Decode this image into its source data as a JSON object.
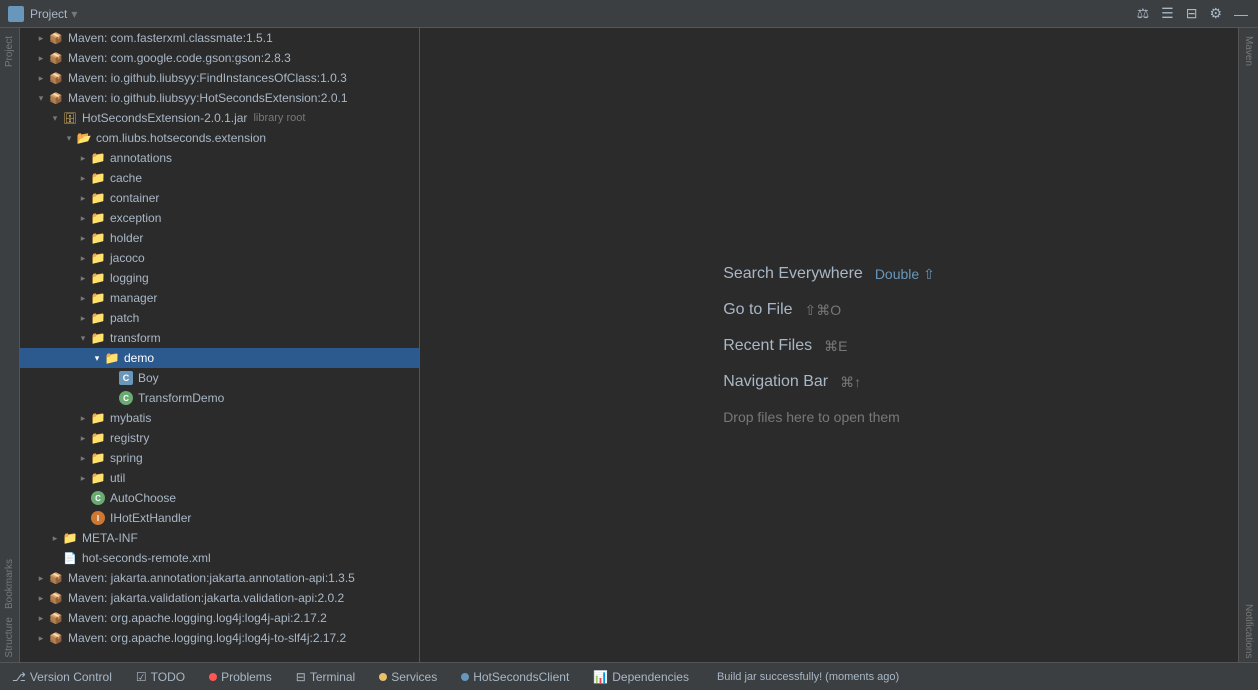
{
  "toolbar": {
    "title": "Project",
    "dropdown_icon": "▾",
    "icons": [
      "balance-icon",
      "list-icon",
      "gear-icon",
      "settings-icon",
      "minimize-icon"
    ]
  },
  "tree": {
    "items": [
      {
        "id": "maven-classmate",
        "label": "Maven: com.fasterxml.classmate:1.5.1",
        "indent": 1,
        "arrow": "closed",
        "icon": "maven",
        "selected": false
      },
      {
        "id": "maven-gson",
        "label": "Maven: com.google.code.gson:gson:2.8.3",
        "indent": 1,
        "arrow": "closed",
        "icon": "maven",
        "selected": false
      },
      {
        "id": "maven-liubsyy",
        "label": "Maven: io.github.liubsyy:FindInstancesOfClass:1.0.3",
        "indent": 1,
        "arrow": "closed",
        "icon": "maven",
        "selected": false
      },
      {
        "id": "maven-hotseconds",
        "label": "Maven: io.github.liubsyy:HotSecondsExtension:2.0.1",
        "indent": 1,
        "arrow": "open",
        "icon": "maven",
        "selected": false
      },
      {
        "id": "hotseconds-jar",
        "label": "HotSecondsExtension-2.0.1.jar",
        "indent": 2,
        "arrow": "open",
        "icon": "jar",
        "label2": "library root",
        "selected": false
      },
      {
        "id": "com-liubs",
        "label": "com.liubs.hotseconds.extension",
        "indent": 3,
        "arrow": "open",
        "icon": "package",
        "selected": false
      },
      {
        "id": "annotations",
        "label": "annotations",
        "indent": 4,
        "arrow": "closed",
        "icon": "folder",
        "selected": false
      },
      {
        "id": "cache",
        "label": "cache",
        "indent": 4,
        "arrow": "closed",
        "icon": "folder",
        "selected": false
      },
      {
        "id": "container",
        "label": "container",
        "indent": 4,
        "arrow": "closed",
        "icon": "folder",
        "selected": false
      },
      {
        "id": "exception",
        "label": "exception",
        "indent": 4,
        "arrow": "closed",
        "icon": "folder",
        "selected": false
      },
      {
        "id": "holder",
        "label": "holder",
        "indent": 4,
        "arrow": "closed",
        "icon": "folder",
        "selected": false
      },
      {
        "id": "jacoco",
        "label": "jacoco",
        "indent": 4,
        "arrow": "closed",
        "icon": "folder",
        "selected": false
      },
      {
        "id": "logging",
        "label": "logging",
        "indent": 4,
        "arrow": "closed",
        "icon": "folder",
        "selected": false
      },
      {
        "id": "manager",
        "label": "manager",
        "indent": 4,
        "arrow": "closed",
        "icon": "folder",
        "selected": false
      },
      {
        "id": "patch",
        "label": "patch",
        "indent": 4,
        "arrow": "closed",
        "icon": "folder",
        "selected": false
      },
      {
        "id": "transform",
        "label": "transform",
        "indent": 4,
        "arrow": "open",
        "icon": "folder",
        "selected": false
      },
      {
        "id": "demo",
        "label": "demo",
        "indent": 5,
        "arrow": "open",
        "icon": "folder",
        "selected": true
      },
      {
        "id": "boy",
        "label": "Boy",
        "indent": 6,
        "arrow": "none",
        "icon": "class",
        "selected": false
      },
      {
        "id": "transformdemo",
        "label": "TransformDemo",
        "indent": 6,
        "arrow": "none",
        "icon": "springclass",
        "selected": false
      },
      {
        "id": "mybatis",
        "label": "mybatis",
        "indent": 4,
        "arrow": "closed",
        "icon": "folder",
        "selected": false
      },
      {
        "id": "registry",
        "label": "registry",
        "indent": 4,
        "arrow": "closed",
        "icon": "folder",
        "selected": false
      },
      {
        "id": "spring",
        "label": "spring",
        "indent": 4,
        "arrow": "closed",
        "icon": "folder",
        "selected": false
      },
      {
        "id": "util",
        "label": "util",
        "indent": 4,
        "arrow": "closed",
        "icon": "folder",
        "selected": false
      },
      {
        "id": "autochoose",
        "label": "AutoChoose",
        "indent": 4,
        "arrow": "none",
        "icon": "springclass",
        "selected": false
      },
      {
        "id": "ihotexthandler",
        "label": "IHotExtHandler",
        "indent": 4,
        "arrow": "none",
        "icon": "springinterface",
        "selected": false
      },
      {
        "id": "meta-inf",
        "label": "META-INF",
        "indent": 2,
        "arrow": "closed",
        "icon": "folder",
        "selected": false
      },
      {
        "id": "hot-seconds-xml",
        "label": "hot-seconds-remote.xml",
        "indent": 2,
        "arrow": "none",
        "icon": "xml",
        "selected": false
      },
      {
        "id": "maven-jakarta-annotation",
        "label": "Maven: jakarta.annotation:jakarta.annotation-api:1.3.5",
        "indent": 1,
        "arrow": "closed",
        "icon": "maven",
        "selected": false
      },
      {
        "id": "maven-jakarta-validation",
        "label": "Maven: jakarta.validation:jakarta.validation-api:2.0.2",
        "indent": 1,
        "arrow": "closed",
        "icon": "maven",
        "selected": false
      },
      {
        "id": "maven-log4j",
        "label": "Maven: org.apache.logging.log4j:log4j-api:2.17.2",
        "indent": 1,
        "arrow": "closed",
        "icon": "maven",
        "selected": false
      },
      {
        "id": "maven-log4j-slf4j",
        "label": "Maven: org.apache.logging.log4j:log4j-to-slf4j:2.17.2",
        "indent": 1,
        "arrow": "closed",
        "icon": "maven",
        "selected": false
      }
    ]
  },
  "welcome": {
    "search_label": "Search Everywhere",
    "search_shortcut": "Double ⇧",
    "goto_label": "Go to File",
    "goto_shortcut": "⇧⌘O",
    "recent_label": "Recent Files",
    "recent_shortcut": "⌘E",
    "navbar_label": "Navigation Bar",
    "navbar_shortcut": "⌘↑",
    "drop_label": "Drop files here to open them"
  },
  "statusbar": {
    "version_control": "Version Control",
    "todo": "TODO",
    "problems": "Problems",
    "terminal": "Terminal",
    "services": "Services",
    "hotseconds": "HotSecondsClient",
    "dependencies": "Dependencies",
    "build_status": "Build jar successfully! (moments ago)"
  },
  "right_panel": {
    "maven_label": "Maven",
    "notifications_label": "Notifications"
  },
  "left_panel": {
    "project_label": "Project",
    "bookmarks_label": "Bookmarks",
    "structure_label": "Structure"
  }
}
